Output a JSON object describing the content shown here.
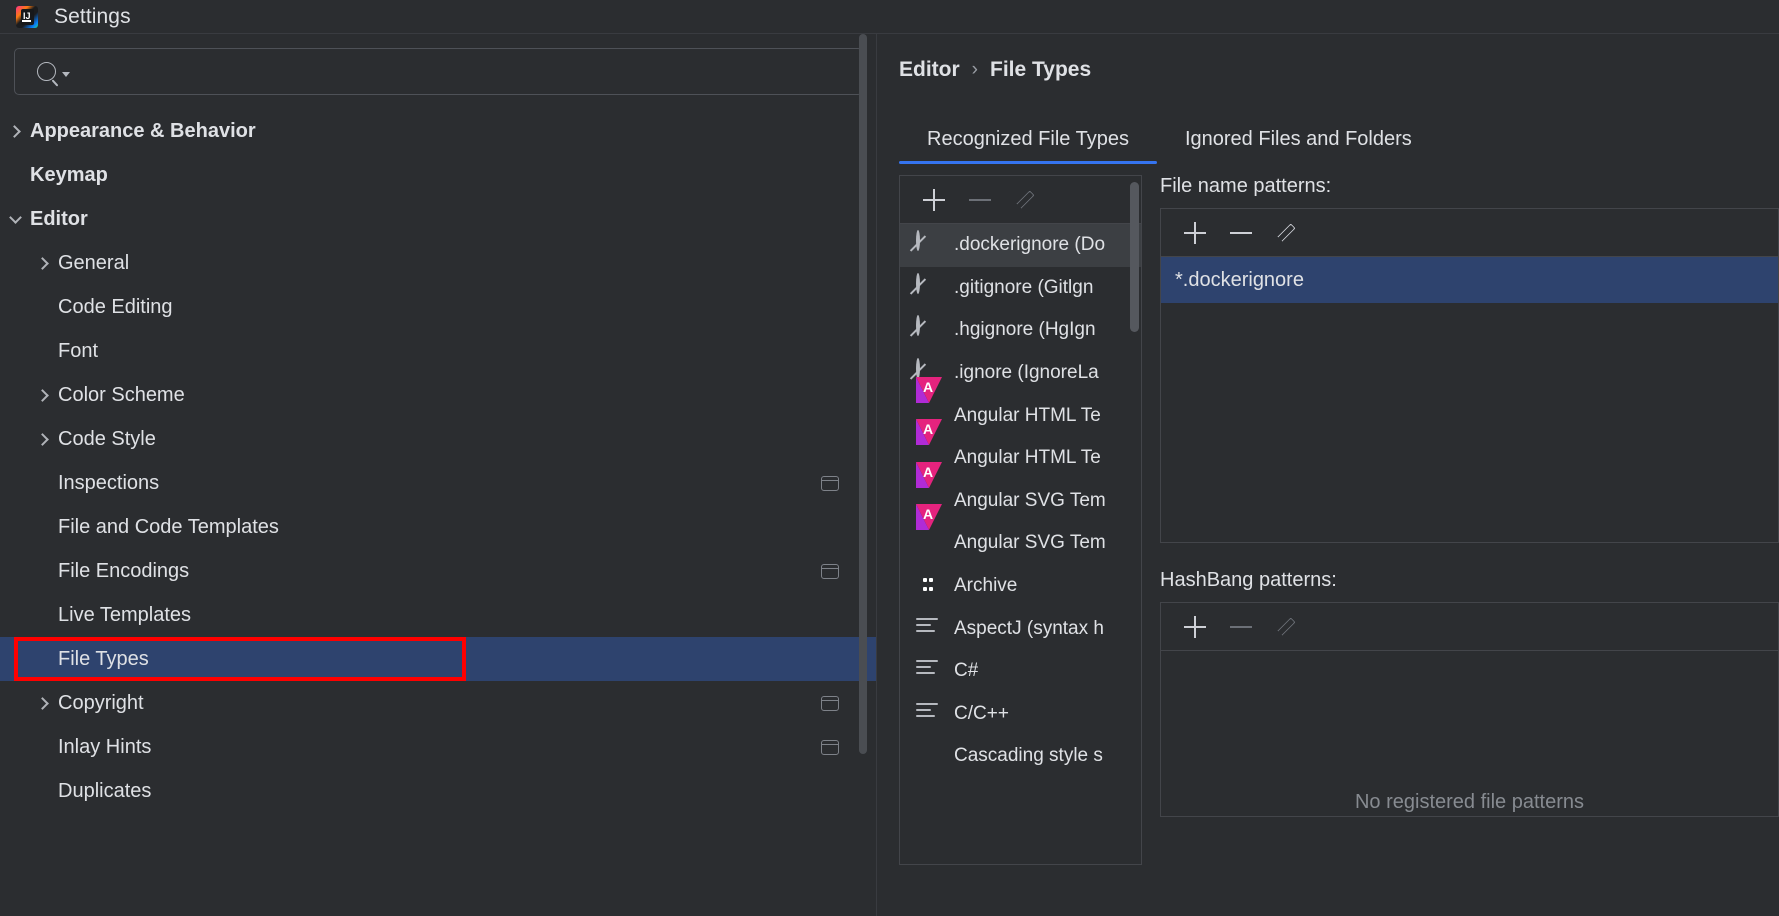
{
  "window": {
    "title": "Settings",
    "logo_icon": "intellij-idea-logo-icon"
  },
  "search": {
    "value": "",
    "placeholder": "",
    "icon": "search-icon",
    "dropdown_icon": "chevron-down-icon"
  },
  "sidebar": {
    "items": [
      {
        "label": "Appearance & Behavior",
        "indent": 0,
        "arrow": "right",
        "bold": true,
        "selected": false,
        "badge": false
      },
      {
        "label": "Keymap",
        "indent": 0,
        "arrow": "none",
        "bold": true,
        "selected": false,
        "badge": false
      },
      {
        "label": "Editor",
        "indent": 0,
        "arrow": "down",
        "bold": true,
        "selected": false,
        "badge": false
      },
      {
        "label": "General",
        "indent": 1,
        "arrow": "right",
        "bold": false,
        "selected": false,
        "badge": false
      },
      {
        "label": "Code Editing",
        "indent": 1,
        "arrow": "none",
        "bold": false,
        "selected": false,
        "badge": false
      },
      {
        "label": "Font",
        "indent": 1,
        "arrow": "none",
        "bold": false,
        "selected": false,
        "badge": false
      },
      {
        "label": "Color Scheme",
        "indent": 1,
        "arrow": "right",
        "bold": false,
        "selected": false,
        "badge": false
      },
      {
        "label": "Code Style",
        "indent": 1,
        "arrow": "right",
        "bold": false,
        "selected": false,
        "badge": false
      },
      {
        "label": "Inspections",
        "indent": 1,
        "arrow": "none",
        "bold": false,
        "selected": false,
        "badge": true
      },
      {
        "label": "File and Code Templates",
        "indent": 1,
        "arrow": "none",
        "bold": false,
        "selected": false,
        "badge": false
      },
      {
        "label": "File Encodings",
        "indent": 1,
        "arrow": "none",
        "bold": false,
        "selected": false,
        "badge": true
      },
      {
        "label": "Live Templates",
        "indent": 1,
        "arrow": "none",
        "bold": false,
        "selected": false,
        "badge": false
      },
      {
        "label": "File Types",
        "indent": 1,
        "arrow": "none",
        "bold": false,
        "selected": true,
        "badge": false,
        "highlight_box": true
      },
      {
        "label": "Copyright",
        "indent": 1,
        "arrow": "right",
        "bold": false,
        "selected": false,
        "badge": true
      },
      {
        "label": "Inlay Hints",
        "indent": 1,
        "arrow": "none",
        "bold": false,
        "selected": false,
        "badge": true
      },
      {
        "label": "Duplicates",
        "indent": 1,
        "arrow": "none",
        "bold": false,
        "selected": false,
        "badge": false
      }
    ]
  },
  "breadcrumb": {
    "parent": "Editor",
    "separator": "›",
    "current": "File Types"
  },
  "tabs": [
    {
      "label": "Recognized File Types",
      "active": true
    },
    {
      "label": "Ignored Files and Folders",
      "active": false
    }
  ],
  "file_types_panel": {
    "toolbar": {
      "add_icon": "plus-icon",
      "remove_icon": "minus-icon",
      "edit_icon": "pencil-icon"
    },
    "items": [
      {
        "name": ".dockerignore (Do",
        "icon": "ignore-icon",
        "selected": true
      },
      {
        "name": ".gitignore (Gitlgn",
        "icon": "ignore-icon",
        "selected": false
      },
      {
        "name": ".hgignore (HgIgn",
        "icon": "ignore-icon",
        "selected": false
      },
      {
        "name": ".ignore (IgnoreLa",
        "icon": "ignore-icon",
        "selected": false
      },
      {
        "name": "Angular HTML Te",
        "icon": "angular-icon",
        "selected": false
      },
      {
        "name": "Angular HTML Te",
        "icon": "angular-icon",
        "selected": false
      },
      {
        "name": "Angular SVG Tem",
        "icon": "angular-icon",
        "selected": false
      },
      {
        "name": "Angular SVG Tem",
        "icon": "angular-icon",
        "selected": false
      },
      {
        "name": "Archive",
        "icon": "archive-icon",
        "selected": false
      },
      {
        "name": "AspectJ (syntax h",
        "icon": "text-lines-icon",
        "selected": false
      },
      {
        "name": "C#",
        "icon": "text-lines-icon",
        "selected": false
      },
      {
        "name": "C/C++",
        "icon": "text-lines-icon",
        "selected": false
      },
      {
        "name": "Cascading style s",
        "icon": "css-icon",
        "selected": false
      }
    ]
  },
  "file_name_patterns": {
    "label": "File name patterns:",
    "toolbar": {
      "add_icon": "plus-icon",
      "remove_icon": "minus-icon",
      "edit_icon": "pencil-icon"
    },
    "items": [
      {
        "value": "*.dockerignore",
        "selected": true
      }
    ]
  },
  "hashbang_patterns": {
    "label": "HashBang patterns:",
    "toolbar": {
      "add_icon": "plus-icon",
      "remove_icon": "minus-icon",
      "edit_icon": "pencil-icon"
    },
    "items": [],
    "empty_text": "No registered file patterns"
  },
  "colors": {
    "background": "#2b2d30",
    "selection": "#2e436e",
    "accent": "#3574f0",
    "highlight_box": "#ff0000",
    "text": "#dfe1e5",
    "muted": "#878b91"
  }
}
